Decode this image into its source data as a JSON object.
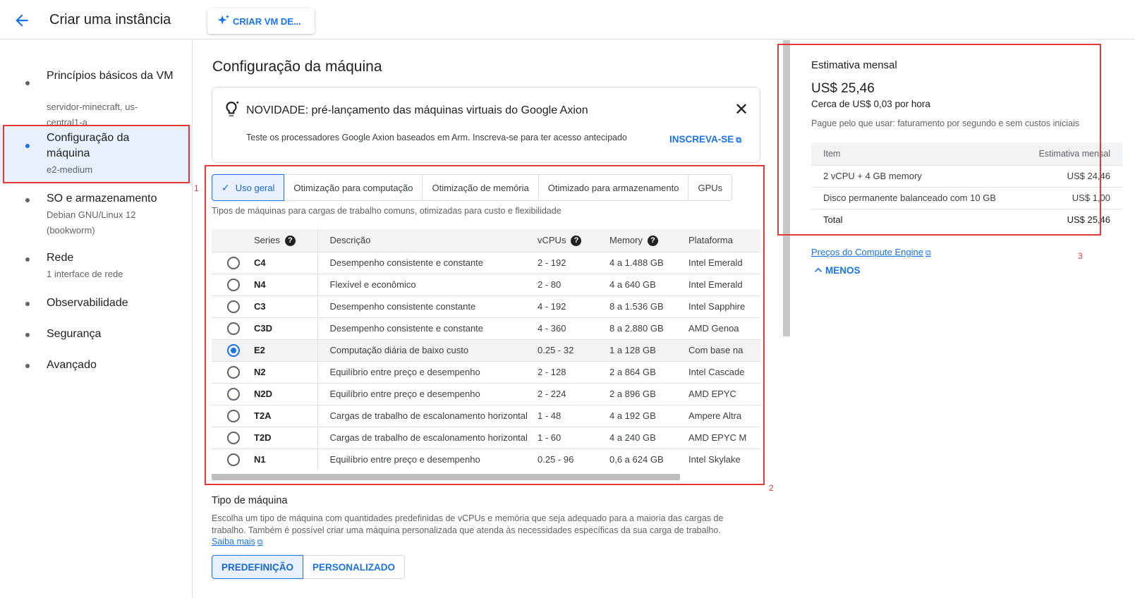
{
  "header": {
    "title": "Criar uma instância",
    "vm_button_label": "CRIAR VM DE..."
  },
  "nav": {
    "items": [
      {
        "label": "Princípios básicos da VM",
        "sub": "servidor-minecraft, us-central1-a"
      },
      {
        "label": "Configuração da máquina",
        "sub": "e2-medium"
      },
      {
        "label": "SO e armazenamento",
        "sub": "Debian GNU/Linux 12 (bookworm)"
      },
      {
        "label": "Rede",
        "sub": "1 interface de rede"
      },
      {
        "label": "Observabilidade",
        "sub": ""
      },
      {
        "label": "Segurança",
        "sub": ""
      },
      {
        "label": "Avançado",
        "sub": ""
      }
    ]
  },
  "annotations": {
    "one": "1",
    "two": "2",
    "three": "3"
  },
  "main": {
    "title": "Configuração da máquina",
    "notice": {
      "title": "NOVIDADE: pré-lançamento das máquinas virtuais do Google Axion",
      "text": "Teste os processadores Google Axion baseados em Arm. Inscreva-se para ter acesso antecipado",
      "link": "INSCREVA-SE"
    },
    "tabs": [
      "Uso geral",
      "Otimização para computação",
      "Otimização de memória",
      "Otimizado para armazenamento",
      "GPUs"
    ],
    "tab_description": "Tipos de máquinas para cargas de trabalho comuns, otimizadas para custo e flexibilidade",
    "table": {
      "headers": {
        "series": "Series",
        "desc": "Descrição",
        "vcpus": "vCPUs",
        "memory": "Memory",
        "platform": "Plataforma"
      },
      "rows": [
        {
          "series": "C4",
          "desc": "Desempenho consistente e constante",
          "vcpus": "2 - 192",
          "memory": "4 a 1.488 GB",
          "platform": "Intel Emerald"
        },
        {
          "series": "N4",
          "desc": "Flexível e econômico",
          "vcpus": "2 - 80",
          "memory": "4 a 640 GB",
          "platform": "Intel Emerald"
        },
        {
          "series": "C3",
          "desc": "Desempenho consistente constante",
          "vcpus": "4 - 192",
          "memory": "8 a 1.536 GB",
          "platform": "Intel Sapphire"
        },
        {
          "series": "C3D",
          "desc": "Desempenho consistente e constante",
          "vcpus": "4 - 360",
          "memory": "8 a 2.880 GB",
          "platform": "AMD Genoa"
        },
        {
          "series": "E2",
          "desc": "Computação diária de baixo custo",
          "vcpus": "0.25 - 32",
          "memory": "1 a 128 GB",
          "platform": "Com base na"
        },
        {
          "series": "N2",
          "desc": "Equilíbrio entre preço e desempenho",
          "vcpus": "2 - 128",
          "memory": "2 a 864 GB",
          "platform": "Intel Cascade"
        },
        {
          "series": "N2D",
          "desc": "Equilíbrio entre preço e desempenho",
          "vcpus": "2 - 224",
          "memory": "2 a 896 GB",
          "platform": "AMD EPYC"
        },
        {
          "series": "T2A",
          "desc": "Cargas de trabalho de escalonamento horizontal",
          "vcpus": "1 - 48",
          "memory": "4 a 192 GB",
          "platform": "Ampere Altra"
        },
        {
          "series": "T2D",
          "desc": "Cargas de trabalho de escalonamento horizontal",
          "vcpus": "1 - 60",
          "memory": "4 a 240 GB",
          "platform": "AMD EPYC M"
        },
        {
          "series": "N1",
          "desc": "Equilíbrio entre preço e desempenho",
          "vcpus": "0.25 - 96",
          "memory": "0,6 a 624 GB",
          "platform": "Intel Skylake"
        }
      ]
    },
    "machine_type": {
      "title": "Tipo de máquina",
      "desc": "Escolha um tipo de máquina com quantidades predefinidas de vCPUs e memória que seja adequado para a maioria das cargas de trabalho. Também é possível criar uma máquina personalizada que atenda às necessidades específicas da sua carga de trabalho.",
      "link": "Saiba mais",
      "btn_preset": "PREDEFINIÇÃO",
      "btn_custom": "PERSONALIZADO"
    }
  },
  "estimate": {
    "title": "Estimativa mensal",
    "price": "US$ 25,46",
    "hourly": "Cerca de US$ 0,03 por hora",
    "note": "Pague pelo que usar: faturamento por segundo e sem custos iniciais",
    "headers": {
      "item": "Item",
      "monthly": "Estimativa mensal"
    },
    "rows": [
      {
        "item": "2 vCPU + 4 GB memory",
        "cost": "US$ 24,46"
      },
      {
        "item": "Disco permanente balanceado com 10 GB",
        "cost": "US$ 1,00"
      },
      {
        "item": "Total",
        "cost": "US$ 25,46"
      }
    ],
    "link": "Preços do Compute Engine",
    "less": "MENOS"
  }
}
